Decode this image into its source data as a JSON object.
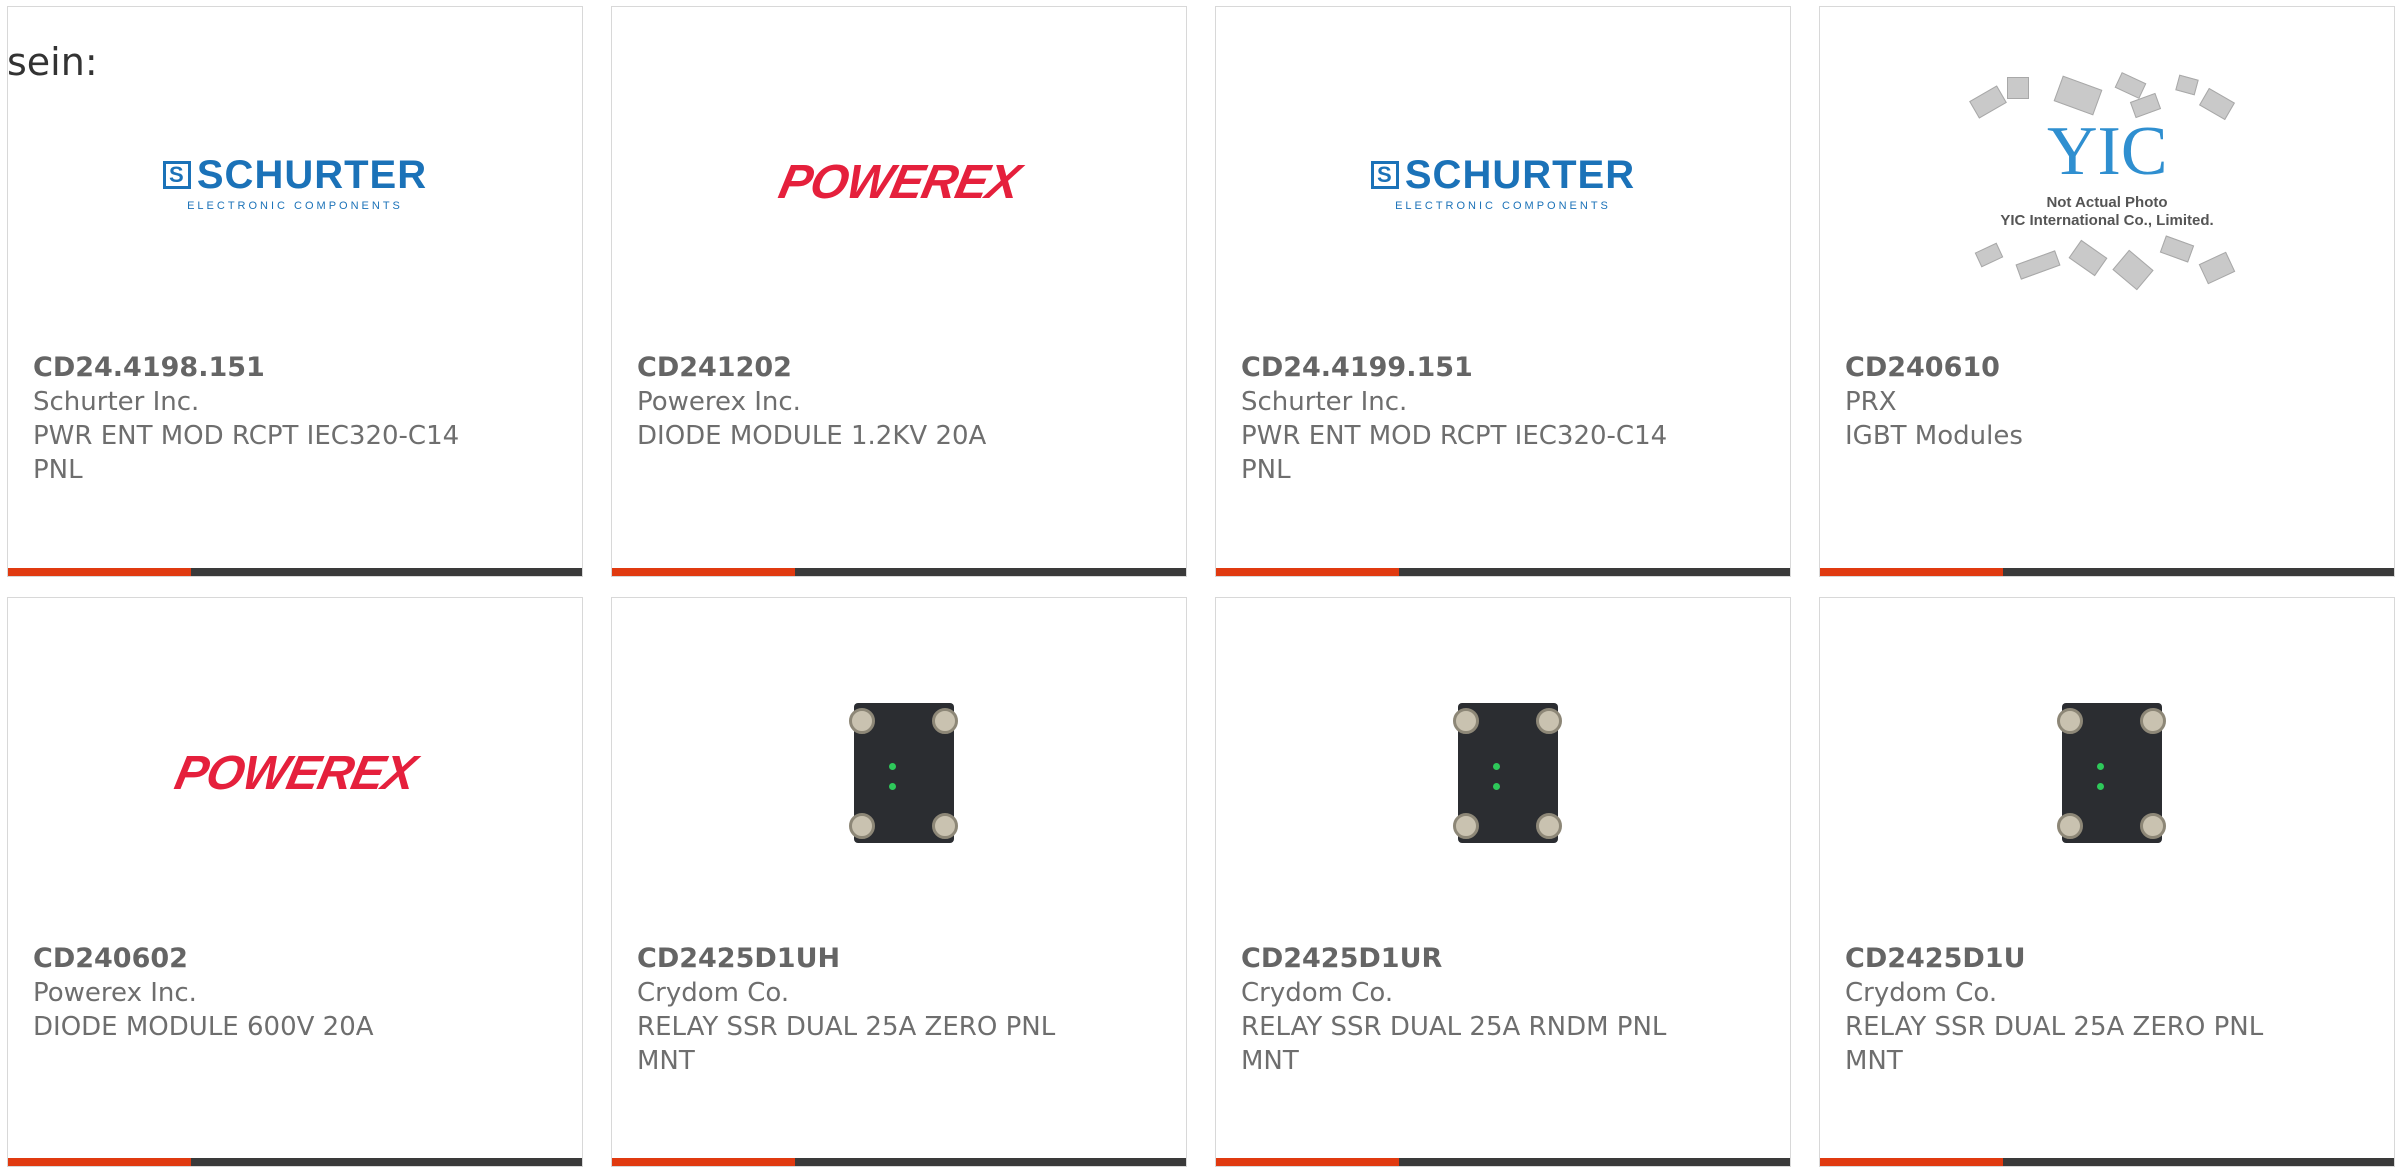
{
  "intro_text": "sein:",
  "products": [
    {
      "part": "CD24.4198.151",
      "maker": "Schurter Inc.",
      "desc": "PWR ENT MOD RCPT IEC320-C14 PNL",
      "image": "schurter-logo"
    },
    {
      "part": "CD241202",
      "maker": "Powerex Inc.",
      "desc": "DIODE MODULE 1.2KV 20A",
      "image": "powerex-logo"
    },
    {
      "part": "CD24.4199.151",
      "maker": "Schurter Inc.",
      "desc": "PWR ENT MOD RCPT IEC320-C14 PNL",
      "image": "schurter-logo"
    },
    {
      "part": "CD240610",
      "maker": "PRX",
      "desc": "IGBT Modules",
      "image": "yic-placeholder"
    },
    {
      "part": "CD240602",
      "maker": "Powerex Inc.",
      "desc": "DIODE MODULE 600V 20A",
      "image": "powerex-logo"
    },
    {
      "part": "CD2425D1UH",
      "maker": "Crydom Co.",
      "desc": "RELAY SSR DUAL 25A ZERO PNL MNT",
      "image": "relay-photo"
    },
    {
      "part": "CD2425D1UR",
      "maker": "Crydom Co.",
      "desc": "RELAY SSR DUAL 25A RNDM PNL MNT",
      "image": "relay-photo"
    },
    {
      "part": "CD2425D1U",
      "maker": "Crydom Co.",
      "desc": "RELAY SSR DUAL 25A ZERO PNL MNT",
      "image": "relay-photo"
    }
  ],
  "logos": {
    "schurter_main": "SCHURTER",
    "schurter_mark": "S",
    "schurter_sub": "ELECTRONIC COMPONENTS",
    "powerex": "POWEREX",
    "yic_mark": "YIC",
    "yic_caption1": "Not Actual Photo",
    "yic_caption2": "YIC International Co., Limited."
  },
  "colors": {
    "accent": "#e03a10",
    "bar": "#3a3a3a",
    "schurter": "#1b72b8",
    "powerex": "#e5203c"
  }
}
